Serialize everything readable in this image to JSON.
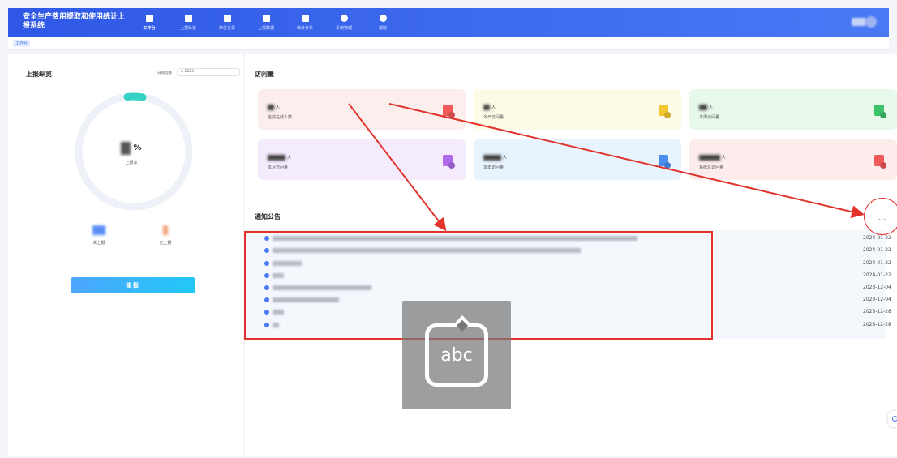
{
  "app": {
    "title": "安全生产费用提取和使用统计上报系统"
  },
  "nav": [
    {
      "label": "工作台",
      "icon": "grid-icon",
      "active": true
    },
    {
      "label": "上报纵览",
      "icon": "document-icon",
      "active": false
    },
    {
      "label": "单位名录",
      "icon": "book-icon",
      "active": false
    },
    {
      "label": "上报数据",
      "icon": "document-icon",
      "active": false
    },
    {
      "label": "统计分析",
      "icon": "chart-icon",
      "active": false
    },
    {
      "label": "系统管理",
      "icon": "gear-icon",
      "active": false
    },
    {
      "label": "帮助",
      "icon": "help-icon",
      "active": false
    }
  ],
  "breadcrumb": {
    "tab": "工作台"
  },
  "overview": {
    "title": "上报纵览",
    "date_label": "日期选择",
    "date_value": "2023",
    "percent_sign": "%",
    "rate_label": "上报率",
    "not_reported_label": "未上报",
    "reported_label": "已上报",
    "remind_button": "催报",
    "ring_color": "#36d1c4"
  },
  "visits": {
    "title": "访问量",
    "unit": "人",
    "cards": [
      {
        "label": "当前在线人数",
        "bg": "#fdeeee",
        "icon_color": "#f05a5a"
      },
      {
        "label": "今日访问量",
        "bg": "#fdfbe6",
        "icon_color": "#f2c62f"
      },
      {
        "label": "本周访问量",
        "bg": "#e8f8ea",
        "icon_color": "#3cc36a"
      },
      {
        "label": "本月访问量",
        "bg": "#f4ebfd",
        "icon_color": "#b06be8"
      },
      {
        "label": "本年访问量",
        "bg": "#e7f3fd",
        "icon_color": "#4a8ff0"
      },
      {
        "label": "系统总访问量",
        "bg": "#fdecec",
        "icon_color": "#f05a5a"
      }
    ]
  },
  "notices": {
    "title": "通知公告",
    "more": "...",
    "items": [
      {
        "date": "2024-01-22"
      },
      {
        "date": "2024-01-22"
      },
      {
        "date": "2024-01-22"
      },
      {
        "date": "2024-01-22"
      },
      {
        "date": "2023-12-04"
      },
      {
        "date": "2023-12-04"
      },
      {
        "date": "2023-12-28"
      },
      {
        "date": "2023-12-28"
      }
    ]
  },
  "keyboard_overlay": {
    "text": "abc"
  },
  "colors": {
    "header": "#2f58e6",
    "annotation": "#e2332c"
  }
}
